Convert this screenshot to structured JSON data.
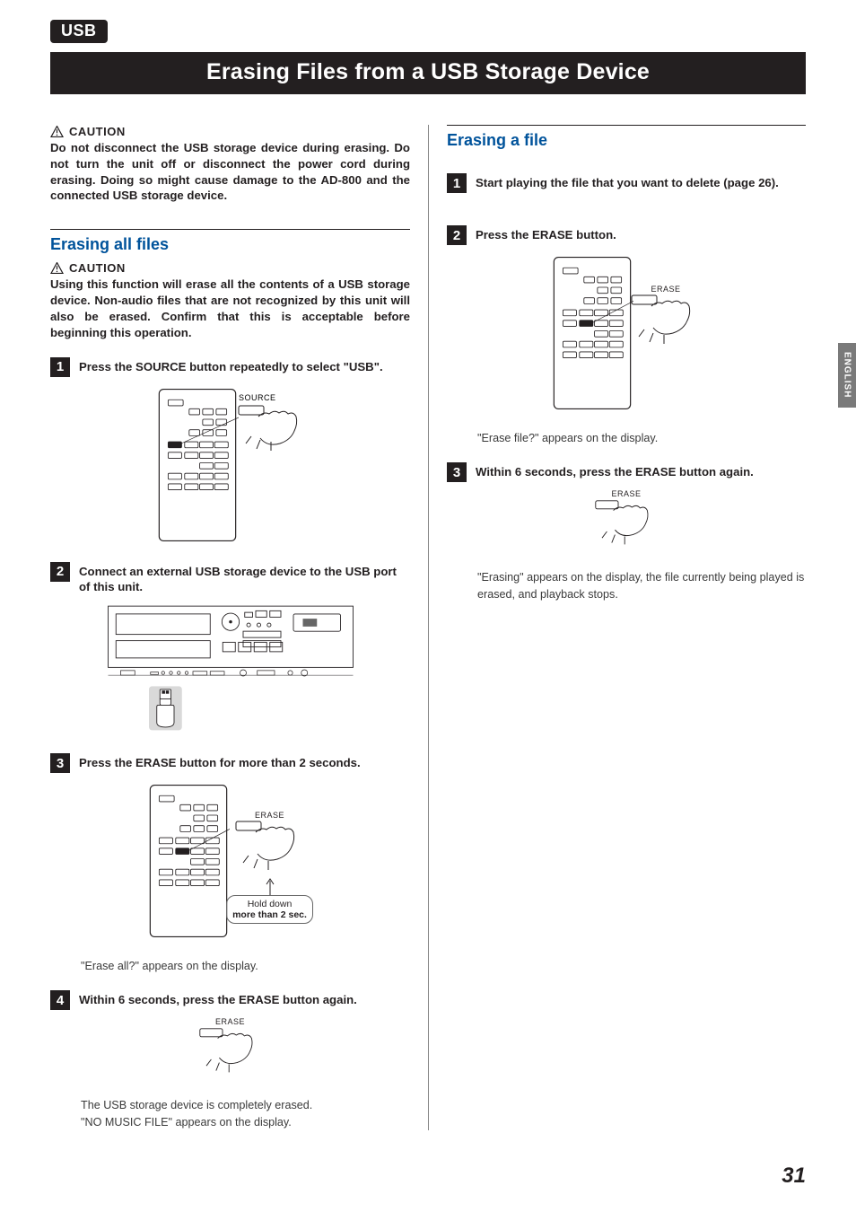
{
  "tag": "USB",
  "title": "Erasing Files from a USB Storage Device",
  "left": {
    "caution1_label": "CAUTION",
    "caution1_text": "Do not disconnect the USB storage device during erasing. Do not turn the unit off or disconnect the power cord during erasing. Doing so might cause damage to the AD-800 and the connected USB storage device.",
    "section_head": "Erasing all files",
    "caution2_label": "CAUTION",
    "caution2_text": "Using this function will erase all the contents of a USB storage device. Non-audio files that are not recognized by this unit will also be erased. Confirm that this is acceptable before beginning this operation.",
    "step1_num": "1",
    "step1_text": "Press the SOURCE button repeatedly to select \"USB\".",
    "step2_num": "2",
    "step2_text": "Connect an external USB storage device to the USB port of this unit.",
    "step3_num": "3",
    "step3_text": "Press the ERASE button for more than 2 seconds.",
    "step3_result": "\"Erase all?\" appears on the display.",
    "step4_num": "4",
    "step4_text": "Within 6 seconds, press the ERASE button again.",
    "step4_result1": "The USB storage device is completely erased.",
    "step4_result2": "\"NO MUSIC FILE\" appears on the display.",
    "fig1_source_label": "SOURCE",
    "fig3_erase_label": "ERASE",
    "fig3_callout_l1": "Hold down",
    "fig3_callout_l2": "more than 2 sec.",
    "fig4_erase_label": "ERASE"
  },
  "right": {
    "section_head": "Erasing a file",
    "step1_num": "1",
    "step1_text": "Start playing the file that you want to delete (page 26).",
    "step2_num": "2",
    "step2_text": "Press the ERASE button.",
    "step2_result": "\"Erase file?\" appears on the display.",
    "step3_num": "3",
    "step3_text": "Within 6 seconds, press the ERASE button again.",
    "step3_result": "\"Erasing\" appears on the display, the file currently being played is erased, and playback stops.",
    "fig2_erase_label": "ERASE",
    "fig3b_erase_label": "ERASE"
  },
  "side_tab": "ENGLISH",
  "page_number": "31"
}
